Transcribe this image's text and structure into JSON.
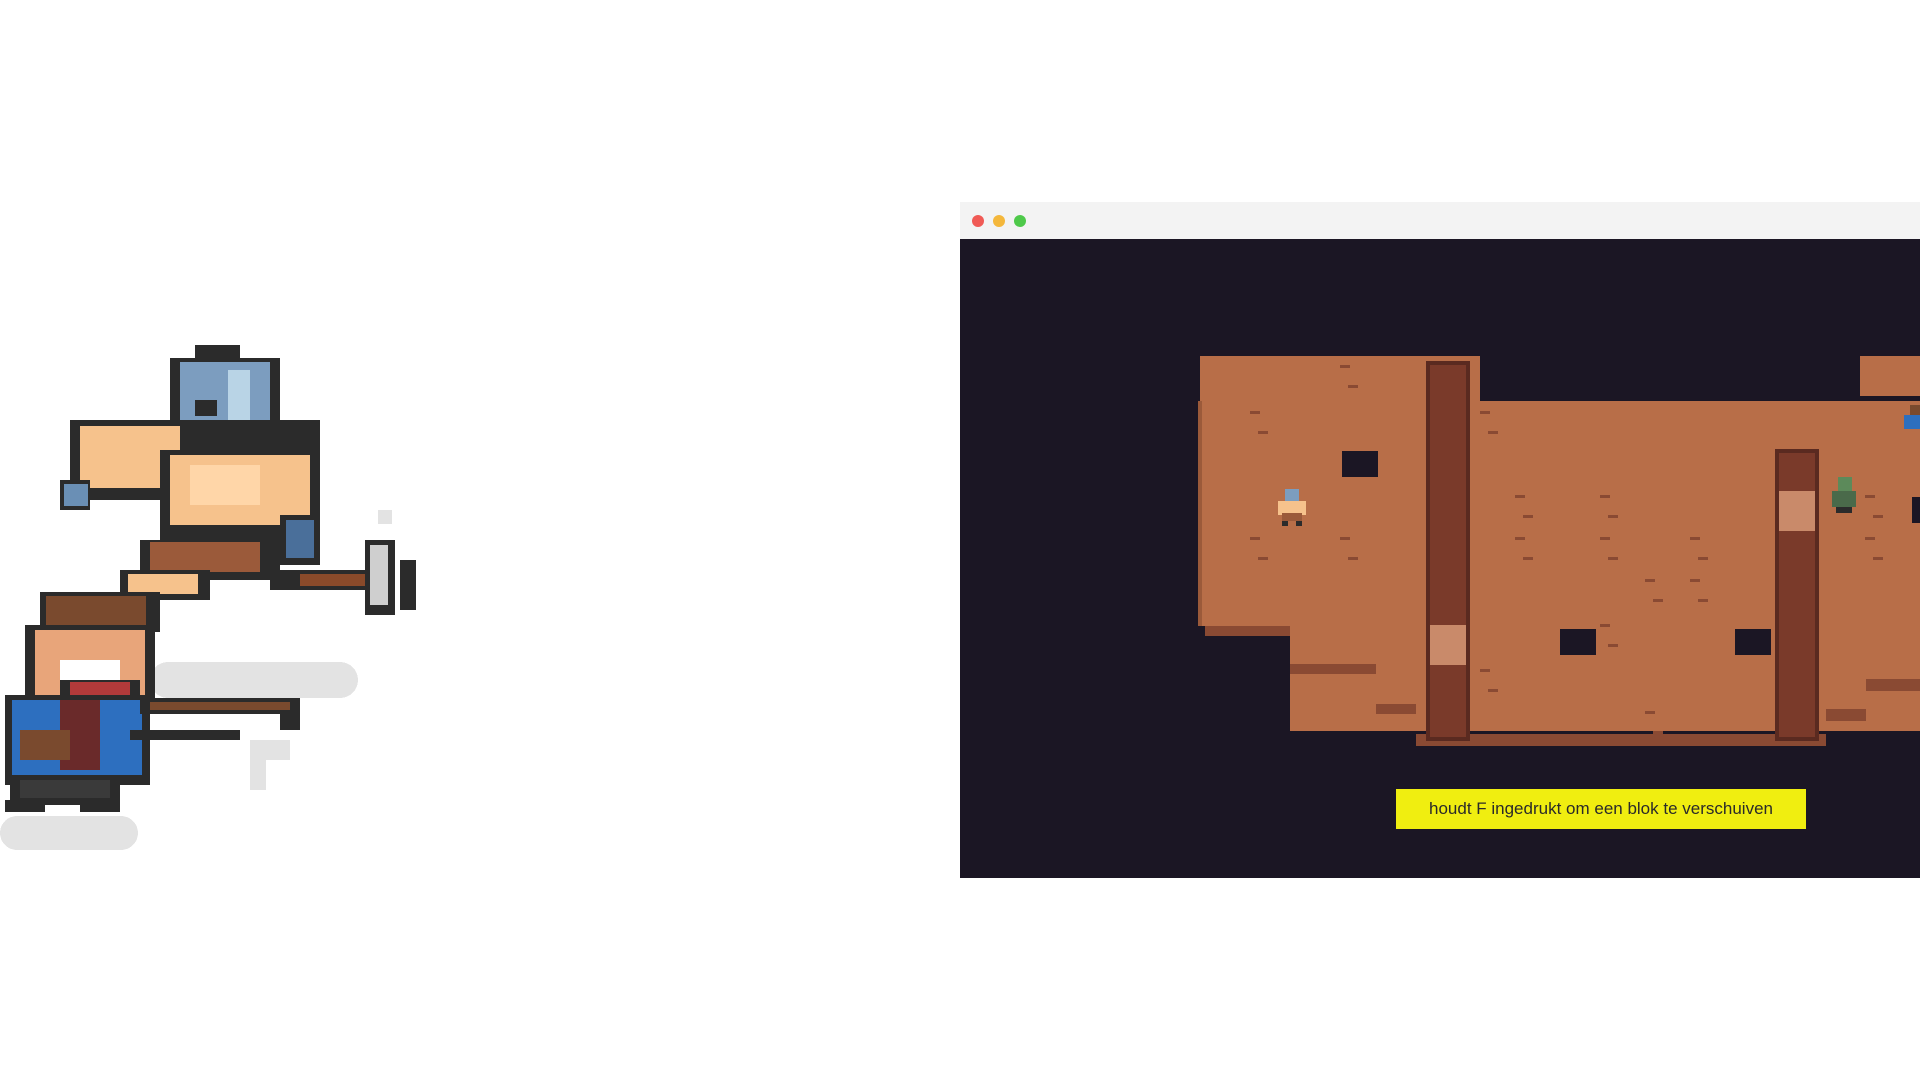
{
  "window": {
    "controls": [
      "close",
      "minimize",
      "maximize"
    ]
  },
  "game": {
    "prompt_text": "houdt F ingedrukt om een blok te verschuiven",
    "colors": {
      "void": "#1b1624",
      "floor": "#b86e48",
      "wall_edge": "#8a4a33",
      "pillar": "#5a2a20",
      "prompt_bg": "#f0ee10"
    }
  },
  "hero_art": {
    "characters": [
      "masked-warrior",
      "crossbow-hero"
    ]
  }
}
